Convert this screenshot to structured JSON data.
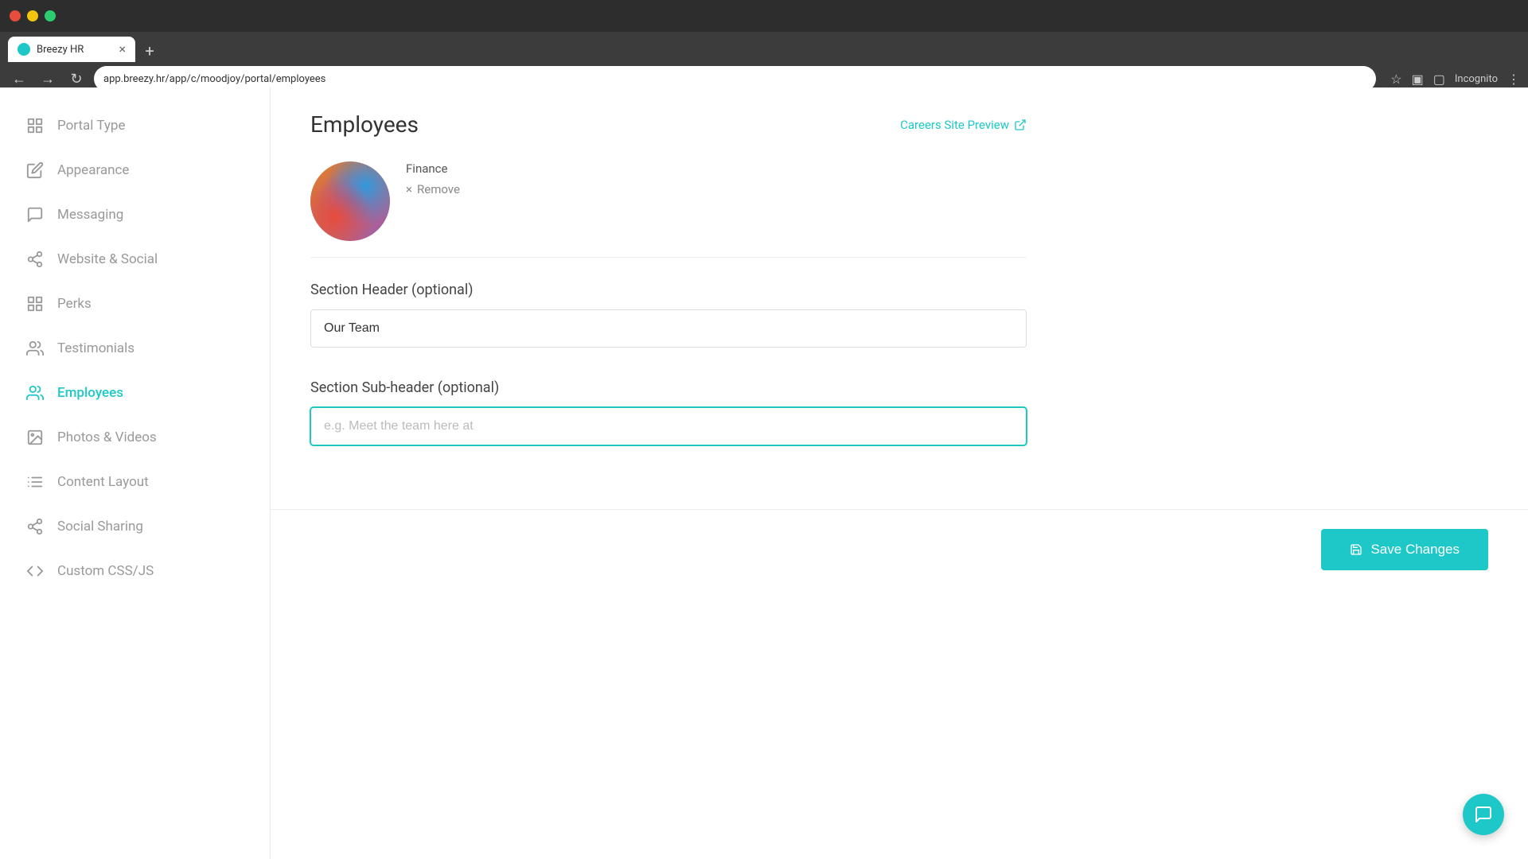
{
  "browser": {
    "tab_title": "Breezy HR",
    "url": "app.breezy.hr/app/c/moodjoy/portal/employees",
    "incognito_label": "Incognito"
  },
  "page": {
    "title": "Employees",
    "preview_link": "Careers Site Preview"
  },
  "image_section": {
    "label": "Finance",
    "remove_label": "Remove"
  },
  "section_header": {
    "label": "Section Header (optional)",
    "value": "Our Team",
    "placeholder": ""
  },
  "section_subheader": {
    "label": "Section Sub-header (optional)",
    "value": "",
    "placeholder": "e.g. Meet the team here at"
  },
  "save_button": {
    "label": "Save Changes"
  },
  "sidebar": {
    "items": [
      {
        "id": "portal-type",
        "label": "Portal Type",
        "icon": "grid"
      },
      {
        "id": "appearance",
        "label": "Appearance",
        "icon": "edit"
      },
      {
        "id": "messaging",
        "label": "Messaging",
        "icon": "message"
      },
      {
        "id": "website-social",
        "label": "Website & Social",
        "icon": "share"
      },
      {
        "id": "perks",
        "label": "Perks",
        "icon": "grid2"
      },
      {
        "id": "testimonials",
        "label": "Testimonials",
        "icon": "users"
      },
      {
        "id": "employees",
        "label": "Employees",
        "icon": "users2",
        "active": true
      },
      {
        "id": "photos-videos",
        "label": "Photos & Videos",
        "icon": "image"
      },
      {
        "id": "content-layout",
        "label": "Content Layout",
        "icon": "layout"
      },
      {
        "id": "social-sharing",
        "label": "Social Sharing",
        "icon": "share2"
      },
      {
        "id": "custom-css",
        "label": "Custom CSS/JS",
        "icon": "code"
      }
    ]
  }
}
